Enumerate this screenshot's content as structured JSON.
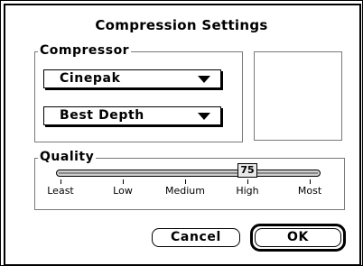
{
  "dialog": {
    "title": "Compression Settings"
  },
  "compressor": {
    "label": "Compressor",
    "codec": "Cinepak",
    "depth": "Best Depth"
  },
  "quality": {
    "label": "Quality",
    "value": "75",
    "value_percent": 75,
    "ticks": [
      "Least",
      "Low",
      "Medium",
      "High",
      "Most"
    ]
  },
  "buttons": {
    "cancel": "Cancel",
    "ok": "OK"
  }
}
